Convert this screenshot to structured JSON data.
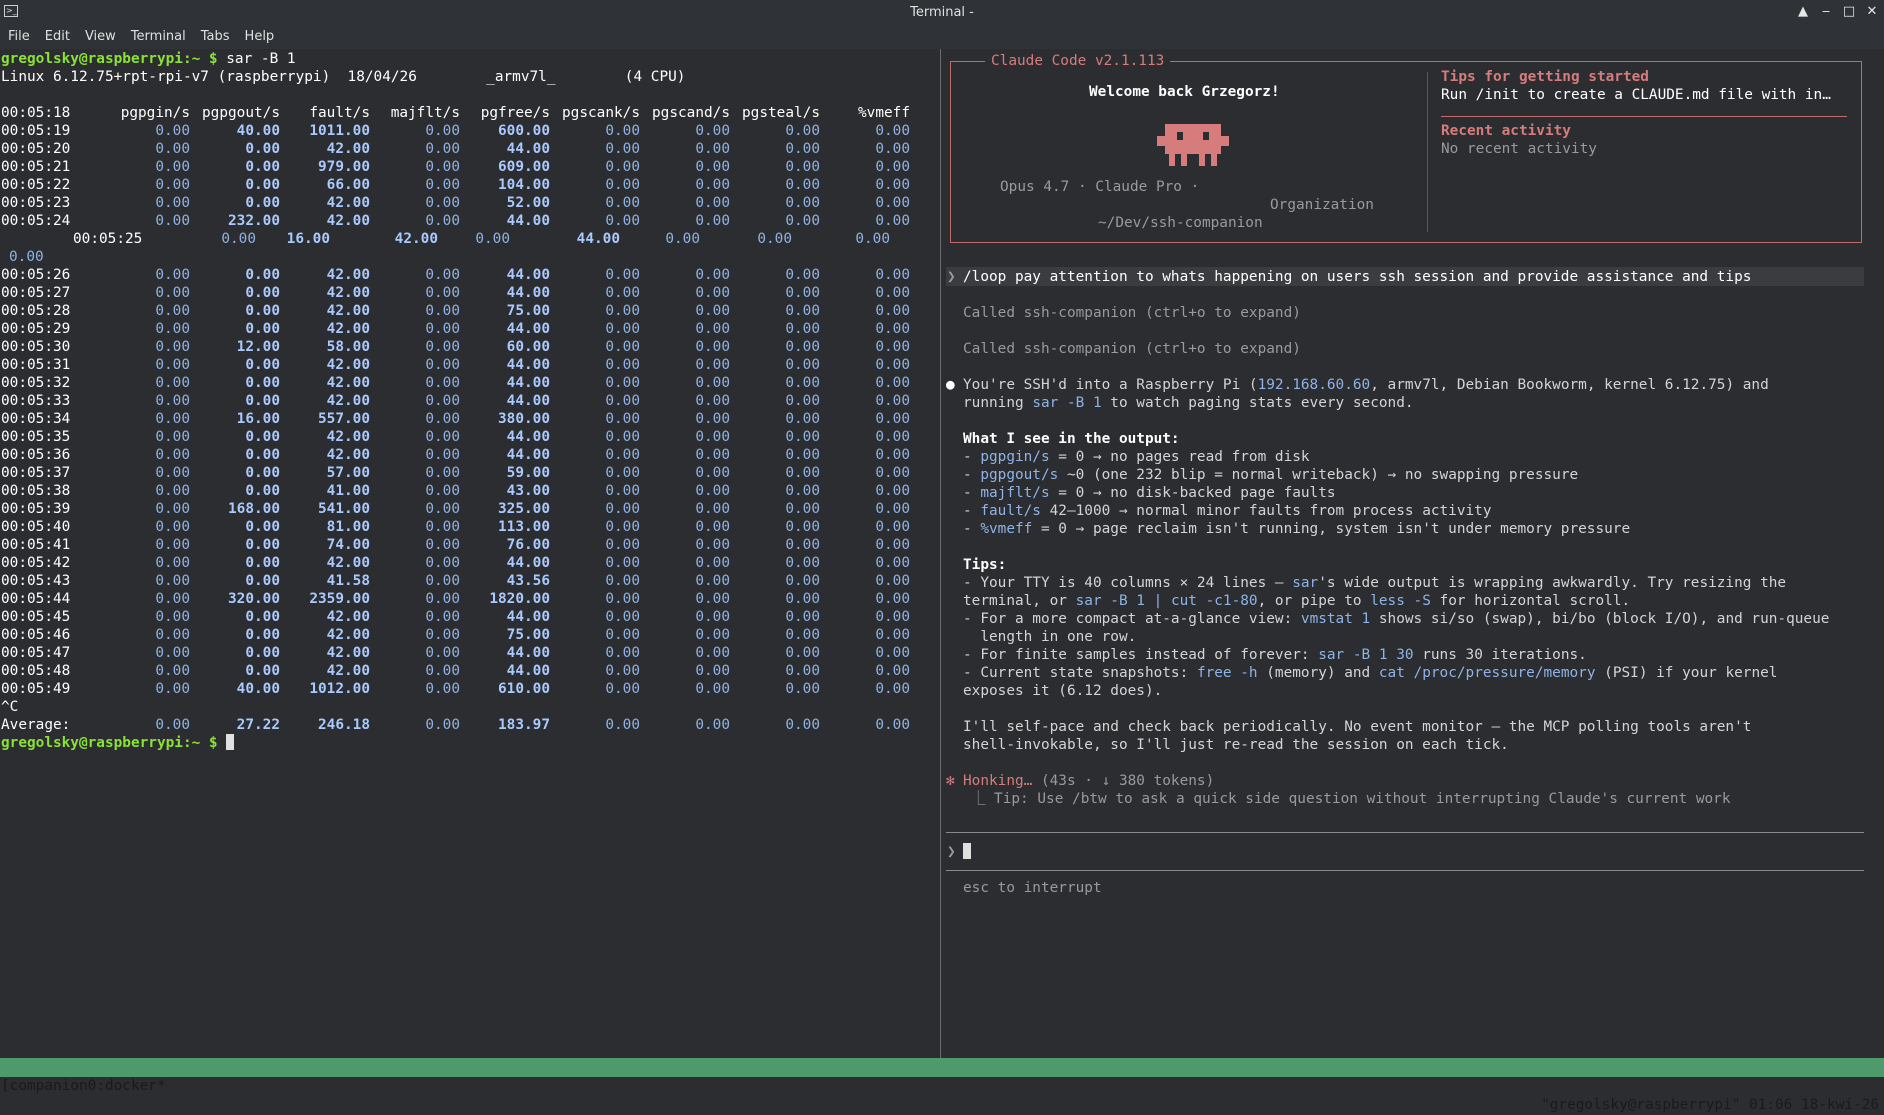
{
  "window": {
    "title": "Terminal -",
    "menu": [
      "File",
      "Edit",
      "View",
      "Terminal",
      "Tabs",
      "Help"
    ]
  },
  "left": {
    "prompt": "gregolsky@raspberrypi:~ $",
    "command": " sar -B 1",
    "sysinfo": "Linux 6.12.75+rpt-rpi-v7 (raspberrypi)  18/04/26        _armv7l_        (4 CPU)",
    "header_time": "00:05:18",
    "headers": [
      "pgpgin/s",
      "pgpgout/s",
      "fault/s",
      "majflt/s",
      "pgfree/s",
      "pgscank/s",
      "pgscand/s",
      "pgsteal/s",
      "%vmeff"
    ],
    "rows_a": [
      [
        "00:05:19",
        "0.00",
        "40.00",
        "1011.00",
        "0.00",
        "600.00",
        "0.00",
        "0.00",
        "0.00",
        "0.00"
      ],
      [
        "00:05:20",
        "0.00",
        "0.00",
        "42.00",
        "0.00",
        "44.00",
        "0.00",
        "0.00",
        "0.00",
        "0.00"
      ],
      [
        "00:05:21",
        "0.00",
        "0.00",
        "979.00",
        "0.00",
        "609.00",
        "0.00",
        "0.00",
        "0.00",
        "0.00"
      ],
      [
        "00:05:22",
        "0.00",
        "0.00",
        "66.00",
        "0.00",
        "104.00",
        "0.00",
        "0.00",
        "0.00",
        "0.00"
      ],
      [
        "00:05:23",
        "0.00",
        "0.00",
        "42.00",
        "0.00",
        "52.00",
        "0.00",
        "0.00",
        "0.00",
        "0.00"
      ],
      [
        "00:05:24",
        "0.00",
        "232.00",
        "42.00",
        "0.00",
        "44.00",
        "0.00",
        "0.00",
        "0.00",
        "0.00"
      ]
    ],
    "wrapped_row": {
      "time": "00:05:25",
      "values": [
        "0.00",
        "16.00",
        "42.00",
        "0.00",
        "44.00",
        "0.00",
        "0.00",
        "0.00"
      ],
      "overflow": "0.00"
    },
    "rows_b": [
      [
        "00:05:26",
        "0.00",
        "0.00",
        "42.00",
        "0.00",
        "44.00",
        "0.00",
        "0.00",
        "0.00",
        "0.00"
      ],
      [
        "00:05:27",
        "0.00",
        "0.00",
        "42.00",
        "0.00",
        "44.00",
        "0.00",
        "0.00",
        "0.00",
        "0.00"
      ],
      [
        "00:05:28",
        "0.00",
        "0.00",
        "42.00",
        "0.00",
        "75.00",
        "0.00",
        "0.00",
        "0.00",
        "0.00"
      ],
      [
        "00:05:29",
        "0.00",
        "0.00",
        "42.00",
        "0.00",
        "44.00",
        "0.00",
        "0.00",
        "0.00",
        "0.00"
      ],
      [
        "00:05:30",
        "0.00",
        "12.00",
        "58.00",
        "0.00",
        "60.00",
        "0.00",
        "0.00",
        "0.00",
        "0.00"
      ],
      [
        "00:05:31",
        "0.00",
        "0.00",
        "42.00",
        "0.00",
        "44.00",
        "0.00",
        "0.00",
        "0.00",
        "0.00"
      ],
      [
        "00:05:32",
        "0.00",
        "0.00",
        "42.00",
        "0.00",
        "44.00",
        "0.00",
        "0.00",
        "0.00",
        "0.00"
      ],
      [
        "00:05:33",
        "0.00",
        "0.00",
        "42.00",
        "0.00",
        "44.00",
        "0.00",
        "0.00",
        "0.00",
        "0.00"
      ],
      [
        "00:05:34",
        "0.00",
        "16.00",
        "557.00",
        "0.00",
        "380.00",
        "0.00",
        "0.00",
        "0.00",
        "0.00"
      ],
      [
        "00:05:35",
        "0.00",
        "0.00",
        "42.00",
        "0.00",
        "44.00",
        "0.00",
        "0.00",
        "0.00",
        "0.00"
      ],
      [
        "00:05:36",
        "0.00",
        "0.00",
        "42.00",
        "0.00",
        "44.00",
        "0.00",
        "0.00",
        "0.00",
        "0.00"
      ],
      [
        "00:05:37",
        "0.00",
        "0.00",
        "57.00",
        "0.00",
        "59.00",
        "0.00",
        "0.00",
        "0.00",
        "0.00"
      ],
      [
        "00:05:38",
        "0.00",
        "0.00",
        "41.00",
        "0.00",
        "43.00",
        "0.00",
        "0.00",
        "0.00",
        "0.00"
      ],
      [
        "00:05:39",
        "0.00",
        "168.00",
        "541.00",
        "0.00",
        "325.00",
        "0.00",
        "0.00",
        "0.00",
        "0.00"
      ],
      [
        "00:05:40",
        "0.00",
        "0.00",
        "81.00",
        "0.00",
        "113.00",
        "0.00",
        "0.00",
        "0.00",
        "0.00"
      ],
      [
        "00:05:41",
        "0.00",
        "0.00",
        "74.00",
        "0.00",
        "76.00",
        "0.00",
        "0.00",
        "0.00",
        "0.00"
      ],
      [
        "00:05:42",
        "0.00",
        "0.00",
        "42.00",
        "0.00",
        "44.00",
        "0.00",
        "0.00",
        "0.00",
        "0.00"
      ],
      [
        "00:05:43",
        "0.00",
        "0.00",
        "41.58",
        "0.00",
        "43.56",
        "0.00",
        "0.00",
        "0.00",
        "0.00"
      ],
      [
        "00:05:44",
        "0.00",
        "320.00",
        "2359.00",
        "0.00",
        "1820.00",
        "0.00",
        "0.00",
        "0.00",
        "0.00"
      ],
      [
        "00:05:45",
        "0.00",
        "0.00",
        "42.00",
        "0.00",
        "44.00",
        "0.00",
        "0.00",
        "0.00",
        "0.00"
      ],
      [
        "00:05:46",
        "0.00",
        "0.00",
        "42.00",
        "0.00",
        "75.00",
        "0.00",
        "0.00",
        "0.00",
        "0.00"
      ],
      [
        "00:05:47",
        "0.00",
        "0.00",
        "42.00",
        "0.00",
        "44.00",
        "0.00",
        "0.00",
        "0.00",
        "0.00"
      ],
      [
        "00:05:48",
        "0.00",
        "0.00",
        "42.00",
        "0.00",
        "44.00",
        "0.00",
        "0.00",
        "0.00",
        "0.00"
      ],
      [
        "00:05:49",
        "0.00",
        "40.00",
        "1012.00",
        "0.00",
        "610.00",
        "0.00",
        "0.00",
        "0.00",
        "0.00"
      ]
    ],
    "interrupt": "^C",
    "average": [
      "Average:",
      "0.00",
      "27.22",
      "246.18",
      "0.00",
      "183.97",
      "0.00",
      "0.00",
      "0.00",
      "0.00"
    ]
  },
  "right": {
    "box_title": "Claude Code v2.1.113",
    "welcome": "Welcome back Grzegorz!",
    "model_line": "Opus 4.7 · Claude Pro ·",
    "org_line": "Organization",
    "cwd": "~/Dev/ssh-companion",
    "tips_title": "Tips for getting started",
    "tips_text": "Run /init to create a CLAUDE.md file with in…",
    "recent_title": "Recent activity",
    "recent_text": "No recent activity",
    "user_prompt": "/loop pay attention to whats happening on users ssh session and provide assistance and tips",
    "called_1": "Called ssh-companion (ctrl+o to expand)",
    "called_2": "Called ssh-companion (ctrl+o to expand)",
    "resp_1a": "You're SSH'd into a Raspberry Pi (",
    "resp_ip": "192.168.60.60",
    "resp_1b": ", armv7l, Debian Bookworm, kernel 6.12.75) and",
    "resp_2a": "running ",
    "resp_sar": "sar -B 1",
    "resp_2b": " to watch paging stats every second.",
    "see_title": "What I see in the output:",
    "see": [
      {
        "code": "pgpgin/s",
        "text": " = 0 → no pages read from disk"
      },
      {
        "code": "pgpgout/s",
        "text": " ~0 (one 232 blip = normal writeback) → no swapping pressure"
      },
      {
        "code": "majflt/s",
        "text": " = 0 → no disk-backed page faults"
      },
      {
        "code": "fault/s",
        "text": " 42–1000 → normal minor faults from process activity"
      },
      {
        "code": "%vmeff",
        "text": " = 0 → page reclaim isn't running, system isn't under memory pressure"
      }
    ],
    "tips_heading": "Tips:",
    "tip1": [
      "- Your TTY is 40 columns × 24 lines — ",
      "sar",
      "'s wide output is wrapping awkwardly. Try resizing the"
    ],
    "tip1b": [
      "terminal, or ",
      "sar -B 1 | cut -c1-80",
      ", or pipe to ",
      "less -S",
      " for horizontal scroll."
    ],
    "tip2": [
      "- For a more compact at-a-glance view: ",
      "vmstat 1",
      " shows si/so (swap), bi/bo (block I/O), and run-queue"
    ],
    "tip2b": "  length in one row.",
    "tip3": [
      "- For finite samples instead of forever: ",
      "sar -B 1 30",
      " runs 30 iterations."
    ],
    "tip4": [
      "- Current state snapshots: ",
      "free -h",
      " (memory) and ",
      "cat /proc/pressure/memory",
      " (PSI) if your kernel"
    ],
    "tip4b": "exposes it (6.12 does).",
    "closing1": "I'll self-pace and check back periodically. No event monitor — the MCP polling tools aren't",
    "closing2": "shell-invokable, so I'll just re-read the session on each tick.",
    "spinner_word": "Honking…",
    "spinner_meta": " (43s · ↓ 380 tokens)",
    "spinner_tip": "⎿ Tip: Use /btw to ask a quick side question without interrupting Claude's current work",
    "input_prompt": "❯",
    "esc_hint": "esc to interrupt"
  },
  "status": {
    "left": "[companion0:docker*",
    "right": "\"gregolsky@raspberrypi\" 01:06 18-kwi-26"
  }
}
